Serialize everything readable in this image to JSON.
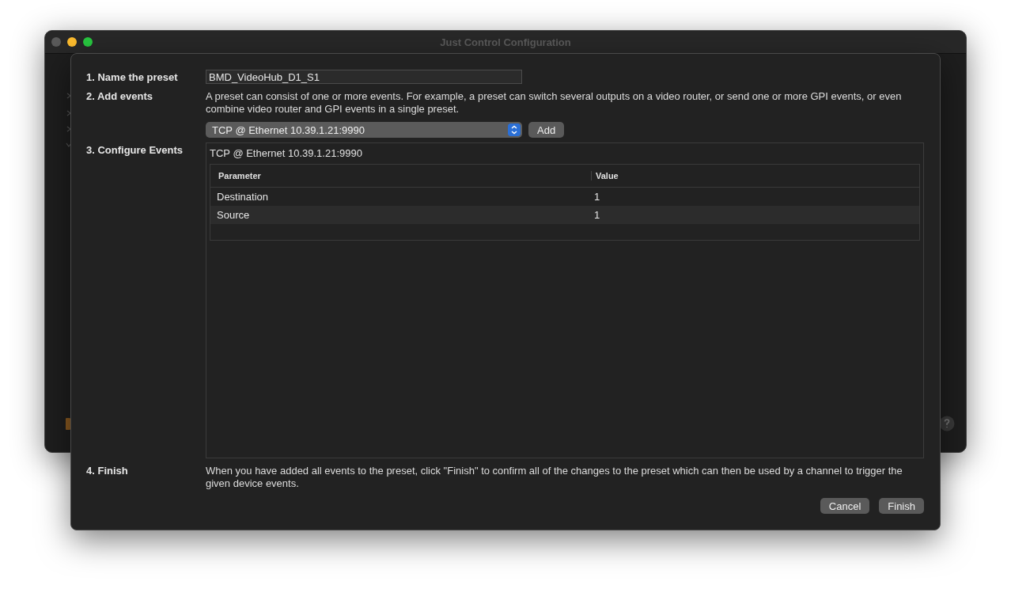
{
  "window": {
    "title": "Just Control Configuration"
  },
  "sheet": {
    "steps": [
      {
        "kind": "name",
        "label": "1. Name the preset",
        "value": "BMD_VideoHub_D1_S1"
      },
      {
        "kind": "add",
        "label": "2. Add events",
        "text": "A preset can consist of one or more events. For example, a preset can switch several outputs on a video router, or send one or more GPI events, or even combine video router and GPI events in a single preset.",
        "device": "TCP @ Ethernet 10.39.1.21:9990",
        "button": "Add"
      },
      {
        "kind": "configure",
        "label": "3. Configure Events",
        "event_title": "TCP @ Ethernet 10.39.1.21:9990",
        "table": {
          "columns": [
            "Parameter",
            "Value"
          ],
          "rows": [
            [
              "Destination",
              "1"
            ],
            [
              "Source",
              "1"
            ]
          ]
        }
      },
      {
        "kind": "finish",
        "label": "4. Finish",
        "text": "When you have added all events to the preset, click \"Finish\" to confirm all of the changes to the preset which can then be used by a channel to trigger the given device events."
      }
    ],
    "buttons": [
      "Cancel",
      "Finish"
    ]
  }
}
